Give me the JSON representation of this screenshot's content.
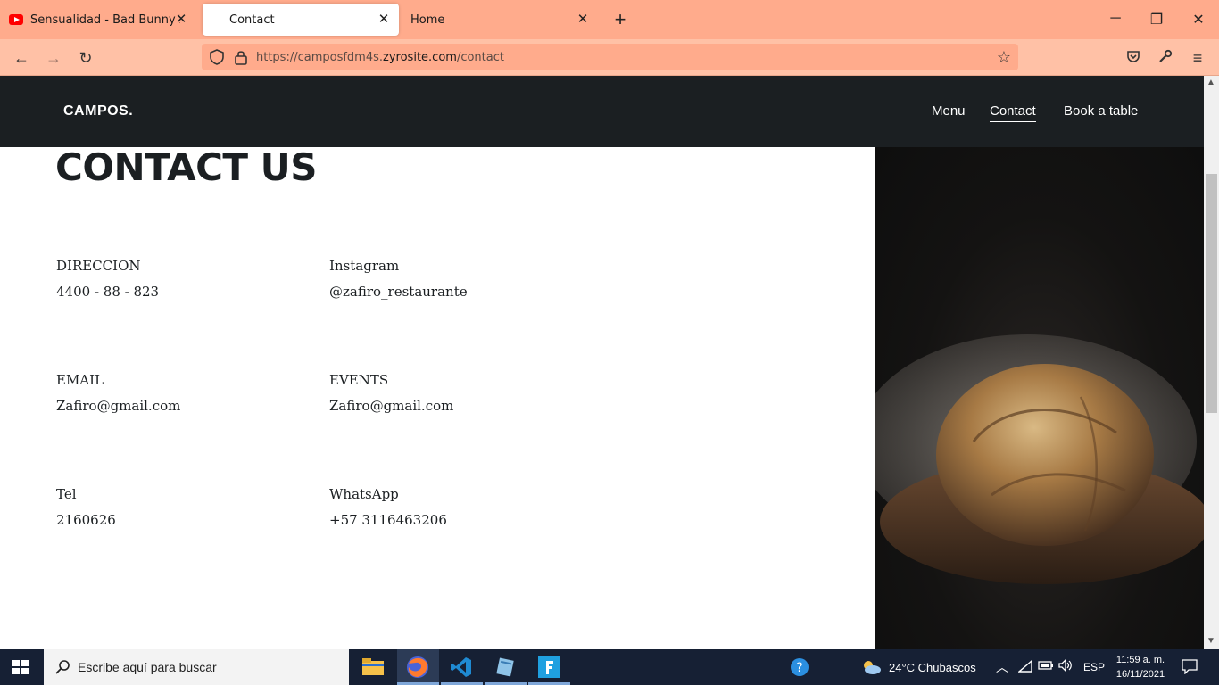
{
  "browser": {
    "tabs": [
      {
        "label": "Sensualidad - Bad Bunny X Prin",
        "icon": "youtube-icon"
      },
      {
        "label": "Contact"
      },
      {
        "label": "Home"
      }
    ],
    "url": {
      "prefix": "https://camposfdm4s.",
      "host": "zyrosite.com",
      "path": "/contact"
    }
  },
  "site": {
    "logo": "CAMPOS.",
    "nav": [
      "Menu",
      "Contact",
      "Book a table"
    ],
    "heading": "CONTACT US",
    "contacts": [
      {
        "label": "DIRECCION",
        "value": "4400 - 88 - 823"
      },
      {
        "label": "Instagram",
        "value": "@zafiro_restaurante"
      },
      {
        "label": "EMAIL",
        "value": "Zafiro@gmail.com"
      },
      {
        "label": "EVENTS",
        "value": "Zafiro@gmail.com"
      },
      {
        "label": "Tel",
        "value": "2160626"
      },
      {
        "label": "WhatsApp",
        "value": "+57 3116463206"
      }
    ]
  },
  "taskbar": {
    "search_placeholder": "Escribe aquí para buscar",
    "weather": "24°C  Chubascos",
    "language": "ESP",
    "time": "11:59 a. m.",
    "date": "16/11/2021"
  },
  "colors": {
    "tab_strip": "#ffab8c",
    "toolbar": "#ffc1a6",
    "site_header": "#1b1f22",
    "taskbar": "#162034"
  }
}
